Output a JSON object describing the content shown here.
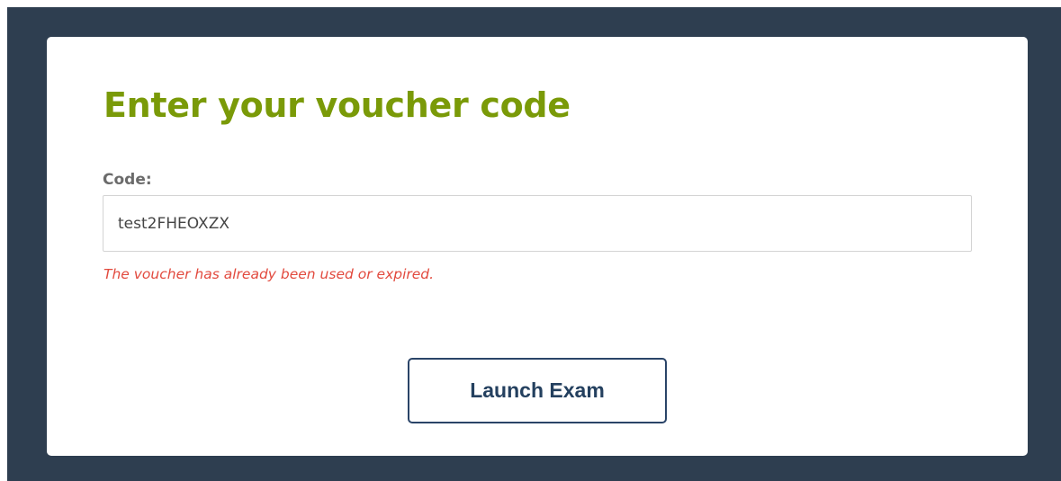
{
  "colors": {
    "backdrop": "#2e3e50",
    "card": "#ffffff",
    "title": "#7a9a08",
    "label": "#6b6b6b",
    "error": "#e24a3e",
    "button_border": "#2a4468",
    "button_text": "#24405f"
  },
  "voucher_form": {
    "title": "Enter your voucher code",
    "code_label": "Code:",
    "code_value": "test2FHEOXZX",
    "error_message": "The voucher has already been used or expired.",
    "launch_label": "Launch Exam"
  }
}
